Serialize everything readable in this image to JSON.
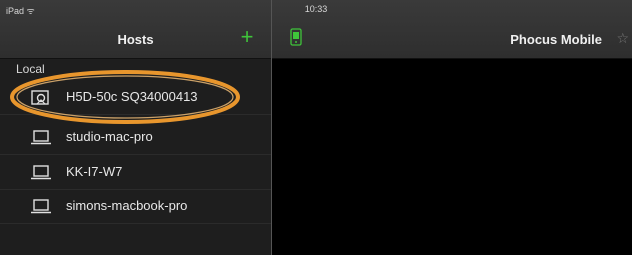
{
  "status_bar": {
    "device": "iPad ᯤ",
    "time": "10:33"
  },
  "sidebar": {
    "title": "Hosts",
    "add_label": "+",
    "section_label": "Local",
    "hosts": [
      {
        "label": "H5D-50c SQ34000413",
        "icon": "camera-icon"
      },
      {
        "label": "studio-mac-pro",
        "icon": "laptop-icon"
      },
      {
        "label": "KK-I7-W7",
        "icon": "laptop-icon"
      },
      {
        "label": "simons-macbook-pro",
        "icon": "laptop-icon"
      }
    ]
  },
  "main": {
    "title": "Phocus Mobile",
    "star": "☆"
  },
  "colors": {
    "accent": "#3fc43a",
    "highlight": "#e8962d"
  }
}
